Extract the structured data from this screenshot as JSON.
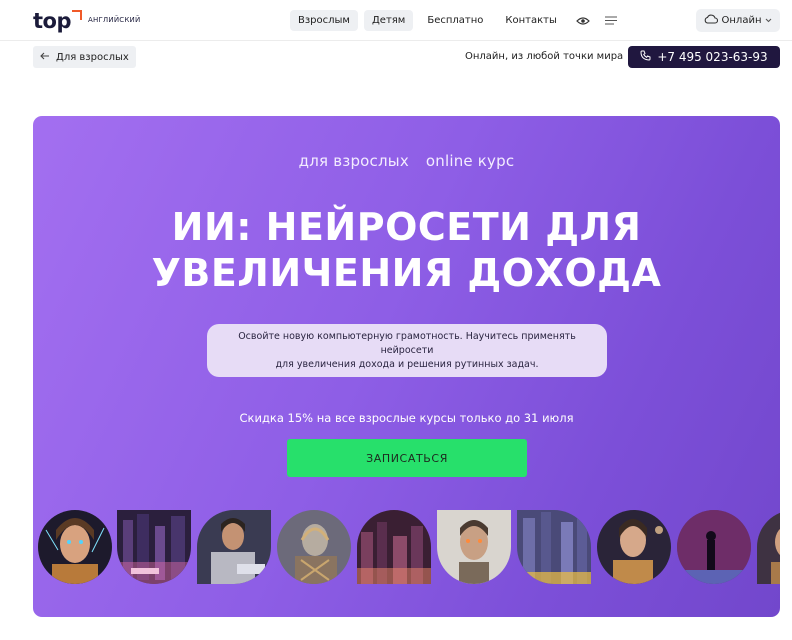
{
  "header": {
    "logo": {
      "word": "top",
      "sub": "АНГЛИЙСКИЙ"
    },
    "nav": [
      {
        "label": "Взрослым",
        "filled": true
      },
      {
        "label": "Детям",
        "filled": true
      },
      {
        "label": "Бесплатно",
        "filled": false
      },
      {
        "label": "Контакты",
        "filled": false
      }
    ],
    "icons": {
      "visibility": "eye-icon",
      "menu": "menu-icon"
    },
    "online_label": "Онлайн"
  },
  "subbar": {
    "back_label": "Для взрослых",
    "reach_text": "Онлайн, из любой точки мира",
    "phone": "+7 495 023-63-93"
  },
  "hero": {
    "tags": [
      "для взрослых",
      "online курс"
    ],
    "title_line1": "ИИ: НЕЙРОСЕТИ ДЛЯ",
    "title_line2": "УВЕЛИЧЕНИЯ ДОХОДА",
    "description_line1": "Освойте новую компьютерную грамотность. Научитесь применять нейросети",
    "description_line2": "для увеличения дохода и решения рутинных задач.",
    "sale": "Скидка 15% на все взрослые курсы только до 31 июля",
    "cta_label": "ЗАПИСАТЬСЯ"
  },
  "colors": {
    "hero_from": "#a36ff0",
    "hero_to": "#7247cc",
    "cta": "#27e06b",
    "phone_bg": "#20173f",
    "logo_accent": "#f05a28"
  }
}
